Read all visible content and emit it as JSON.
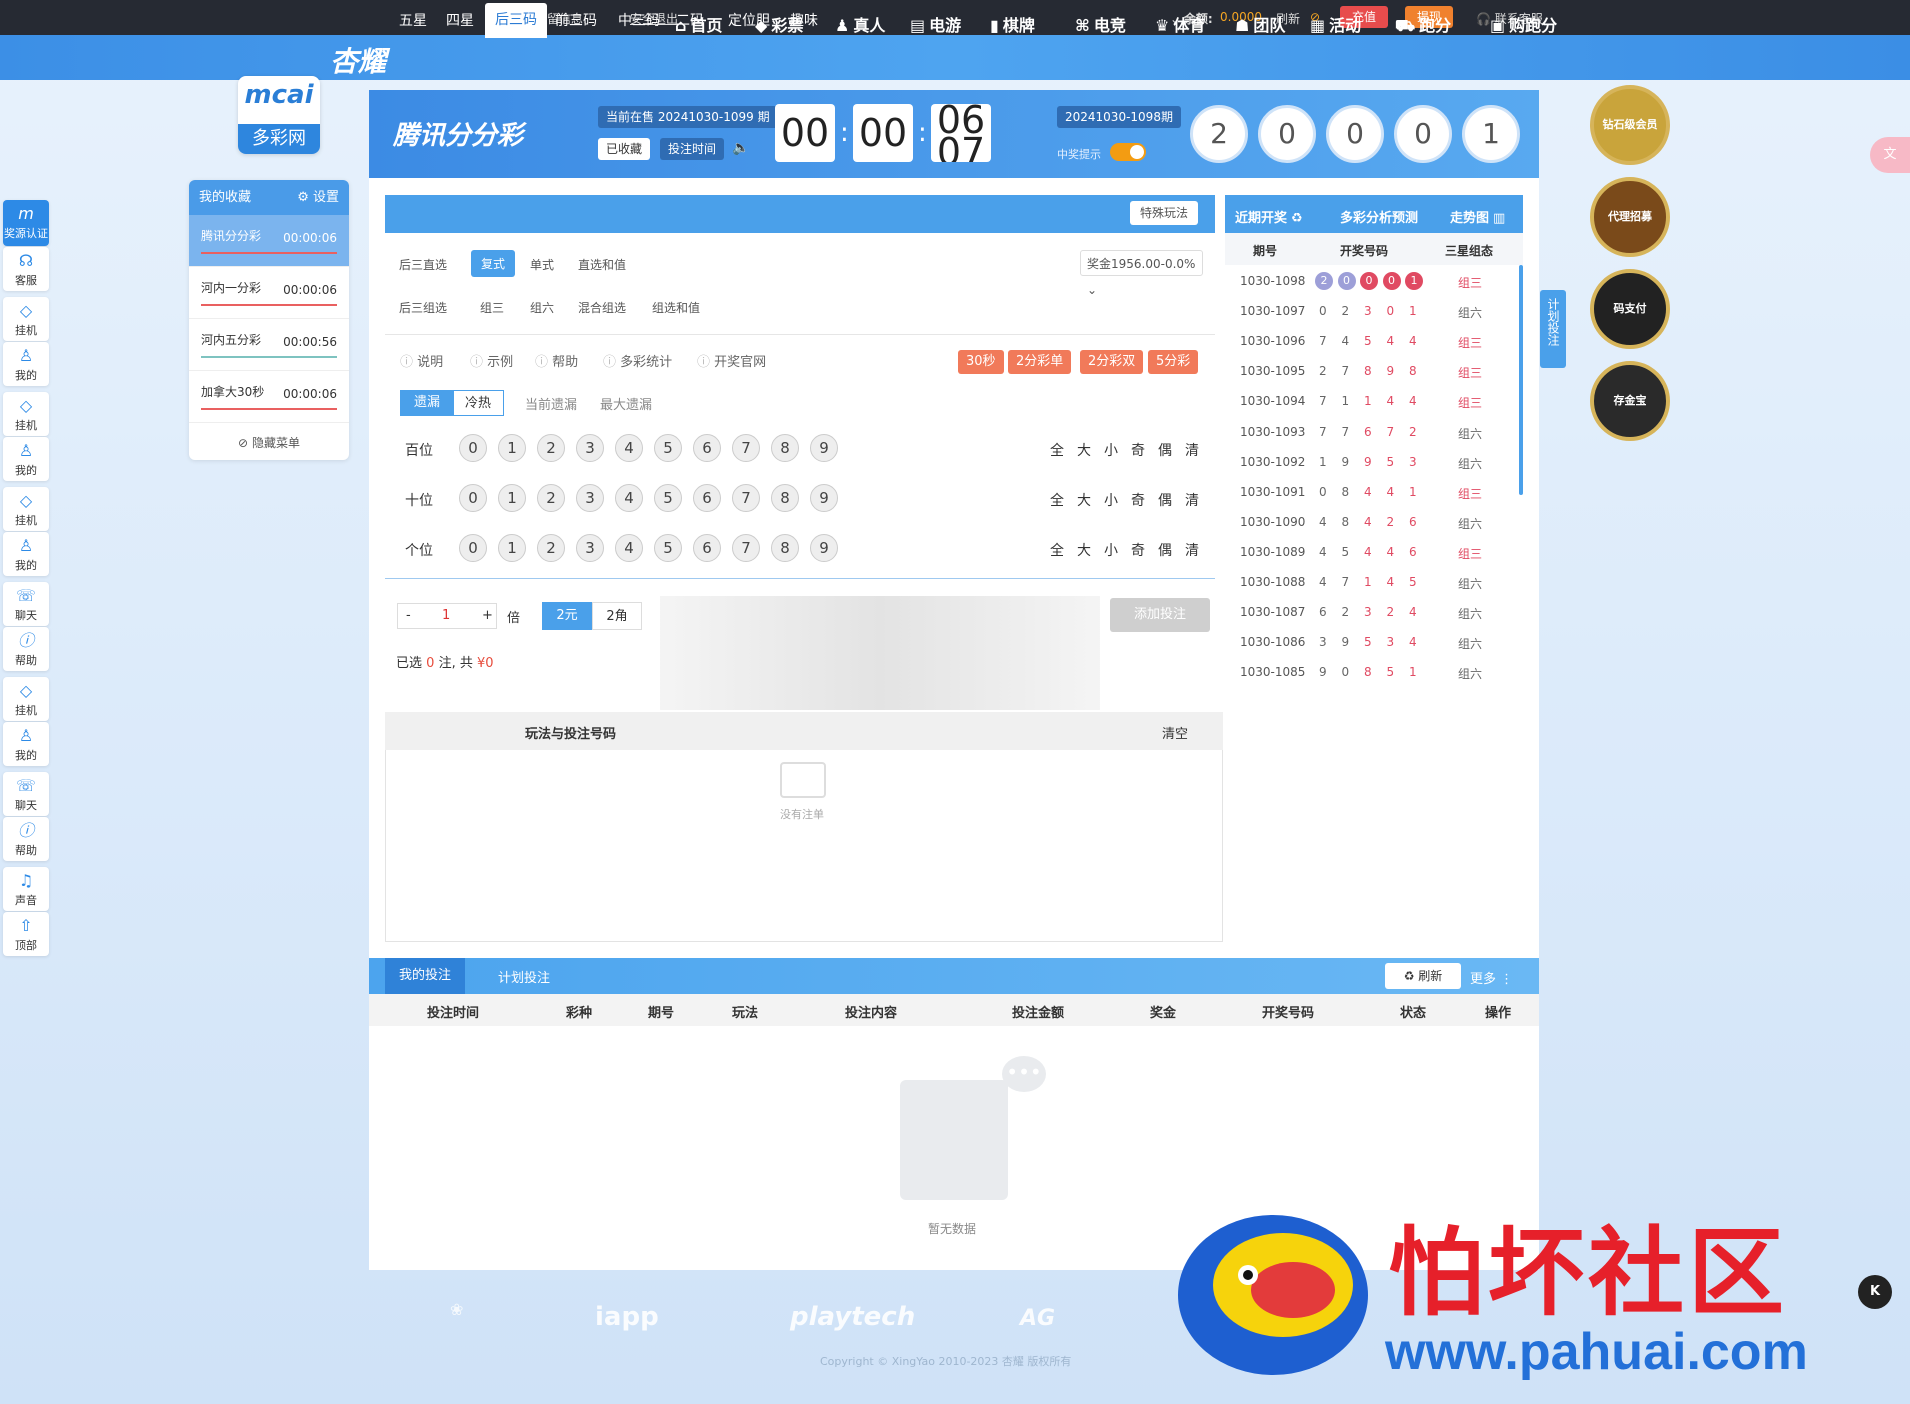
{
  "topbar": {
    "notice_label": "预留信息:",
    "logout": "安全退出",
    "balance_label": "余额:",
    "balance": "0.0000",
    "refresh": "刷新",
    "recharge": "充值",
    "withdraw": "提现",
    "support": "联系客服"
  },
  "brand": {
    "logo": "杏耀",
    "mcai_logo": "mcai",
    "mcai_sub": "多彩网"
  },
  "nav": [
    {
      "icon": "home-icon",
      "label": "首页"
    },
    {
      "icon": "ticket-icon",
      "label": "彩票"
    },
    {
      "icon": "person-icon",
      "label": "真人"
    },
    {
      "icon": "slot-icon",
      "label": "电游"
    },
    {
      "icon": "card-icon",
      "label": "棋牌"
    },
    {
      "icon": "gamepad-icon",
      "label": "电竞"
    },
    {
      "icon": "trophy-icon",
      "label": "体育"
    },
    {
      "icon": "team-icon",
      "label": "团队"
    },
    {
      "icon": "gift-icon",
      "label": "活动"
    },
    {
      "icon": "car-icon",
      "label": "跑分"
    },
    {
      "icon": "h-icon",
      "label": "购跑分"
    }
  ],
  "favorites": {
    "title": "我的收藏",
    "settings": "设置",
    "hide": "隐藏菜单",
    "items": [
      {
        "name": "腾讯分分彩",
        "time": "00:00:06"
      },
      {
        "name": "河内一分彩",
        "time": "00:00:06"
      },
      {
        "name": "河内五分彩",
        "time": "00:00:56"
      },
      {
        "name": "加拿大30秒",
        "time": "00:00:06"
      }
    ]
  },
  "game": {
    "logo": "腾讯分分彩",
    "on_sale": "当前在售 20241030-1099 期",
    "collected": "已收藏",
    "bet_time": "投注时间",
    "clock": [
      "00",
      "00",
      "06"
    ],
    "clock_next": "07",
    "last_issue": "20241030-1098期",
    "notify": "中奖提示",
    "last_result": [
      "2",
      "0",
      "0",
      "0",
      "1"
    ]
  },
  "tabs": [
    "五星",
    "四星",
    "后三码",
    "前三码",
    "中三码",
    "二码",
    "定位胆",
    "趣味"
  ],
  "special": "特殊玩法",
  "subtabs1": [
    "后三直选",
    "复式",
    "单式",
    "直选和值"
  ],
  "subtabs2": [
    "后三组选",
    "组三",
    "组六",
    "混合组选",
    "组选和值"
  ],
  "odds": "奖金1956.00-0.0%",
  "infolinks": [
    "说明",
    "示例",
    "帮助",
    "多彩统计",
    "开奖官网"
  ],
  "quick_games": [
    "30秒",
    "2分彩单",
    "2分彩双",
    "5分彩"
  ],
  "omit": {
    "tabs": [
      "遗漏",
      "冷热"
    ],
    "current": "当前遗漏",
    "max": "最大遗漏"
  },
  "positions": [
    "百位",
    "十位",
    "个位"
  ],
  "digits": [
    "0",
    "1",
    "2",
    "3",
    "4",
    "5",
    "6",
    "7",
    "8",
    "9"
  ],
  "quickfilters": [
    "全",
    "大",
    "小",
    "奇",
    "偶",
    "清"
  ],
  "multiplier": {
    "value": "1",
    "unit": "倍",
    "yuan": "2元",
    "jiao": "2角",
    "add": "添加投注"
  },
  "selected": {
    "prefix": "已选",
    "count": "0",
    "mid": "注, 共",
    "amount": "¥0"
  },
  "betlist": {
    "header": "玩法与投注号码",
    "clear": "清空",
    "empty": "没有注单"
  },
  "history": {
    "tabs": [
      "近期开奖",
      "多彩分析预测",
      "走势图"
    ],
    "cols": [
      "期号",
      "开奖号码",
      "三星组态"
    ],
    "rows": [
      {
        "issue": "1030-1098",
        "nums": [
          "2",
          "0",
          "0",
          "0",
          "1"
        ],
        "type": "组三"
      },
      {
        "issue": "1030-1097",
        "nums": [
          "0",
          "2",
          "3",
          "0",
          "1"
        ],
        "type": "组六"
      },
      {
        "issue": "1030-1096",
        "nums": [
          "7",
          "4",
          "5",
          "4",
          "4"
        ],
        "type": "组三"
      },
      {
        "issue": "1030-1095",
        "nums": [
          "2",
          "7",
          "8",
          "9",
          "8"
        ],
        "type": "组三"
      },
      {
        "issue": "1030-1094",
        "nums": [
          "7",
          "1",
          "1",
          "4",
          "4"
        ],
        "type": "组三"
      },
      {
        "issue": "1030-1093",
        "nums": [
          "7",
          "7",
          "6",
          "7",
          "2"
        ],
        "type": "组六"
      },
      {
        "issue": "1030-1092",
        "nums": [
          "1",
          "9",
          "9",
          "5",
          "3"
        ],
        "type": "组六"
      },
      {
        "issue": "1030-1091",
        "nums": [
          "0",
          "8",
          "4",
          "4",
          "1"
        ],
        "type": "组三"
      },
      {
        "issue": "1030-1090",
        "nums": [
          "4",
          "8",
          "4",
          "2",
          "6"
        ],
        "type": "组六"
      },
      {
        "issue": "1030-1089",
        "nums": [
          "4",
          "5",
          "4",
          "4",
          "6"
        ],
        "type": "组三"
      },
      {
        "issue": "1030-1088",
        "nums": [
          "4",
          "7",
          "1",
          "4",
          "5"
        ],
        "type": "组六"
      },
      {
        "issue": "1030-1087",
        "nums": [
          "6",
          "2",
          "3",
          "2",
          "4"
        ],
        "type": "组六"
      },
      {
        "issue": "1030-1086",
        "nums": [
          "3",
          "9",
          "5",
          "3",
          "4"
        ],
        "type": "组六"
      },
      {
        "issue": "1030-1085",
        "nums": [
          "9",
          "0",
          "8",
          "5",
          "1"
        ],
        "type": "组六"
      }
    ]
  },
  "plan_bet_tab": "计划投注",
  "mybets": {
    "tabs": [
      "我的投注",
      "计划投注"
    ],
    "refresh": "刷新",
    "more": "更多",
    "cols": [
      "投注时间",
      "彩种",
      "期号",
      "玩法",
      "投注内容",
      "投注金额",
      "奖金",
      "开奖号码",
      "状态",
      "操作"
    ],
    "empty": "暂无数据"
  },
  "badges": [
    "钻石级会员",
    "代理招募",
    "码支付",
    "存金宝"
  ],
  "sidebar": [
    {
      "icon": "mcai-icon",
      "label": "奖源认证"
    },
    {
      "icon": "headset-icon",
      "label": "客服"
    },
    {
      "icon": "diamond-icon",
      "label": "挂机"
    },
    {
      "icon": "user-icon",
      "label": "我的"
    },
    {
      "icon": "diamond-icon",
      "label": "挂机"
    },
    {
      "icon": "user-icon",
      "label": "我的"
    },
    {
      "icon": "diamond-icon",
      "label": "挂机"
    },
    {
      "icon": "user-icon",
      "label": "我的"
    },
    {
      "icon": "chat-icon",
      "label": "聊天"
    },
    {
      "icon": "info-icon",
      "label": "帮助"
    },
    {
      "icon": "diamond-icon",
      "label": "挂机"
    },
    {
      "icon": "user-icon",
      "label": "我的"
    },
    {
      "icon": "chat-icon",
      "label": "聊天"
    },
    {
      "icon": "info-icon",
      "label": "帮助"
    },
    {
      "icon": "speaker-icon",
      "label": "声音"
    },
    {
      "icon": "arrow-up-icon",
      "label": "顶部"
    }
  ],
  "footer": {
    "partners": [
      "iapp",
      "playtech",
      "AG"
    ],
    "copyright": "Copyright © XingYao 2010-2023 杏耀 版权所有"
  },
  "watermark": {
    "title": "怕坏社区",
    "url": "www.pahuai.com"
  }
}
